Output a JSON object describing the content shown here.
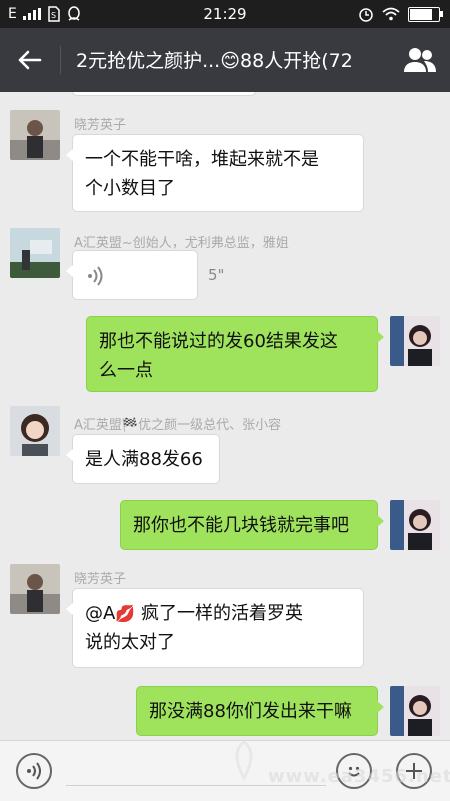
{
  "status_bar": {
    "carrier": "E",
    "time": "21:29",
    "battery_level": 0.85
  },
  "header": {
    "title": "2元抢优之颜护...😊88人开抢(72"
  },
  "messages": [
    {
      "sender": "晓芳英子",
      "text_line1": "一个不能干啥，堆起来就不是",
      "text_line2": "个小数目了"
    },
    {
      "sender": "A汇英盟~创始人，尤利弗总监，雅姐",
      "voice_length": "5\""
    },
    {
      "text_line1": "那也不能说过的发60结果发这",
      "text_line2": "么一点"
    },
    {
      "sender": "A汇英盟🏁优之颜一级总代、张小容",
      "text": "是人满88发66"
    },
    {
      "text": "那你也不能几块钱就完事吧"
    },
    {
      "sender": "晓芳英子",
      "mention": "@A",
      "text_line1_rest": " 疯了一样的活着罗英",
      "text_line2": "说的太对了",
      "emoji": "💋"
    },
    {
      "text": "那没满88你们发出来干嘛"
    }
  ],
  "toolbar": {
    "voice_icon": "voice-toggle-icon",
    "emoji_icon": "emoji-face-icon",
    "plus_icon": "plus-icon"
  },
  "watermark": {
    "text": "www.ea3456.net"
  },
  "colors": {
    "header_bg": "#393a3f",
    "status_bg": "#1e1e1e",
    "chat_bg": "#ebebeb",
    "outgoing_bubble": "#9fe35c",
    "incoming_bubble": "#ffffff"
  }
}
